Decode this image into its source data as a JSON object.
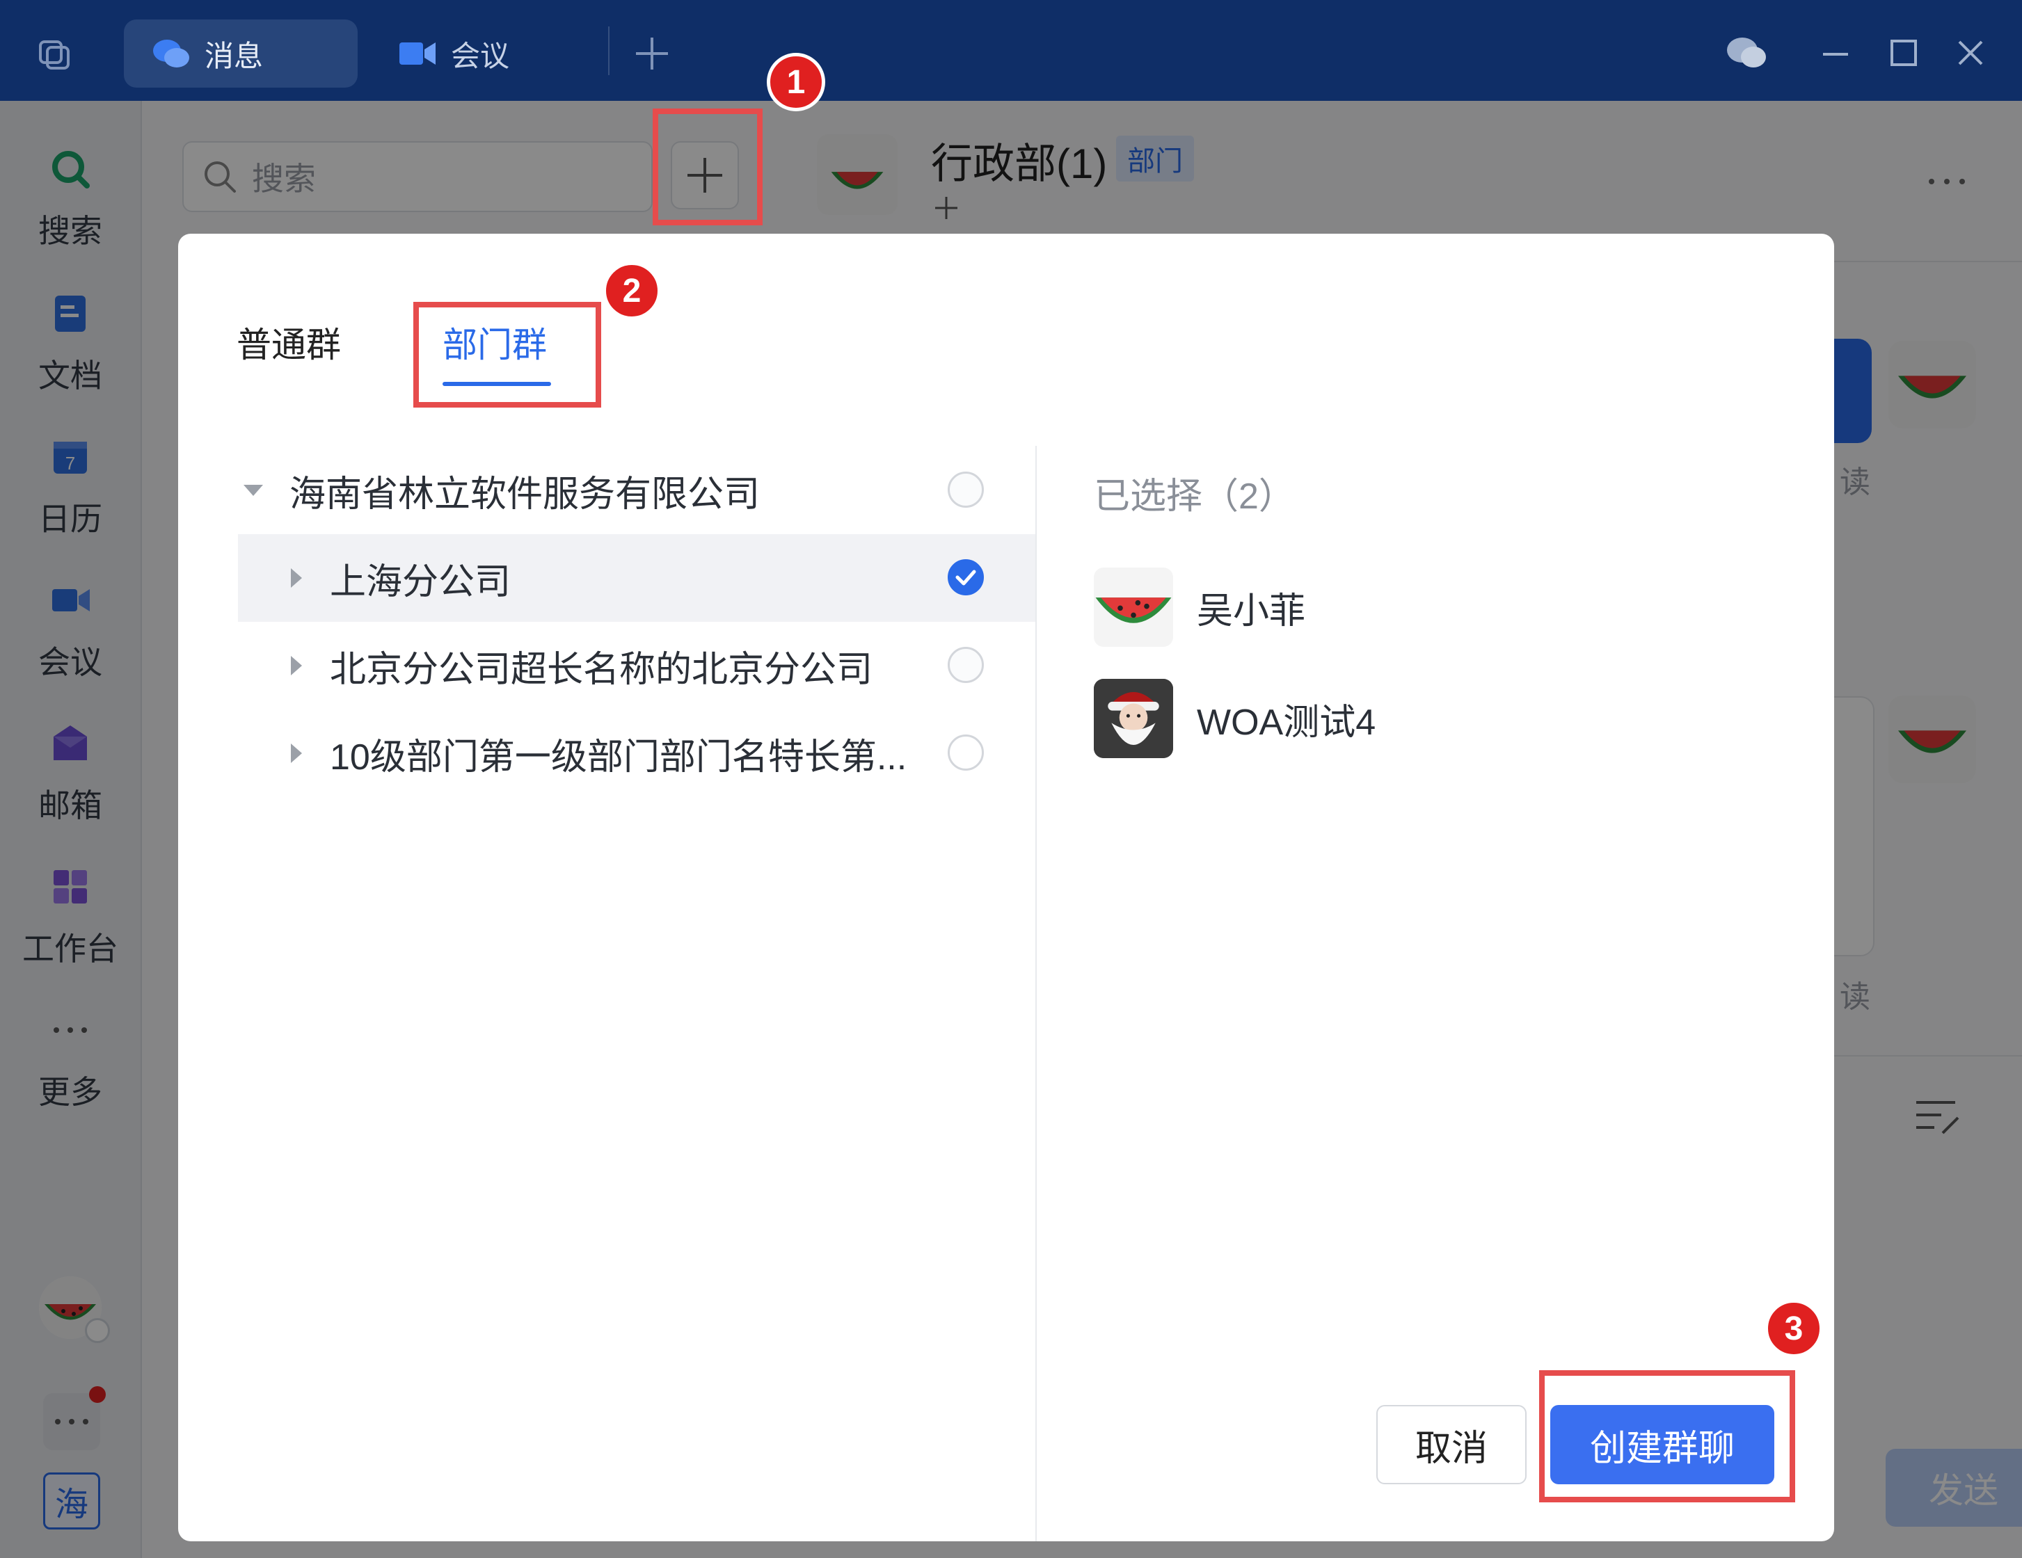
{
  "titlebar": {
    "tabs": [
      {
        "label": "消息",
        "icon": "chat-bubbles-icon",
        "active": true
      },
      {
        "label": "会议",
        "icon": "video-camera-icon",
        "active": false
      }
    ]
  },
  "sidebar": {
    "items": [
      {
        "label": "搜索",
        "icon": "search-icon"
      },
      {
        "label": "文档",
        "icon": "document-icon"
      },
      {
        "label": "日历",
        "icon": "calendar-icon"
      },
      {
        "label": "会议",
        "icon": "video-camera-icon"
      },
      {
        "label": "邮箱",
        "icon": "mailbox-icon"
      },
      {
        "label": "工作台",
        "icon": "workbench-icon"
      },
      {
        "label": "更多",
        "icon": "more-dots-icon"
      }
    ],
    "bottom_org_label": "海"
  },
  "main": {
    "search_placeholder": "搜索",
    "chat_title": "行政部(1)",
    "chat_tag": "部门",
    "read_label_1": "读",
    "read_label_2": "读",
    "send_label": "发送"
  },
  "modal": {
    "tabs": [
      {
        "label": "普通群",
        "active": false
      },
      {
        "label": "部门群",
        "active": true
      }
    ],
    "tree": [
      {
        "label": "海南省林立软件服务有限公司",
        "level": 0,
        "expanded": true,
        "checked": false
      },
      {
        "label": "上海分公司",
        "level": 1,
        "expanded": false,
        "checked": true
      },
      {
        "label": "北京分公司超长名称的北京分公司",
        "level": 1,
        "expanded": false,
        "checked": false
      },
      {
        "label": "10级部门第一级部门部门名特长第...",
        "level": 1,
        "expanded": false,
        "checked": false
      }
    ],
    "selected_title": "已选择（2）",
    "selected": [
      {
        "name": "吴小菲",
        "avatar": "watermelon-avatar"
      },
      {
        "name": "WOA测试4",
        "avatar": "santa-avatar"
      }
    ],
    "cancel_label": "取消",
    "create_label": "创建群聊"
  },
  "annotations": [
    "1",
    "2",
    "3"
  ],
  "colors": {
    "titlebar": "#0f2e67",
    "primary": "#2a6ae8",
    "highlight": "#e64c4c",
    "badge": "#e02020"
  }
}
